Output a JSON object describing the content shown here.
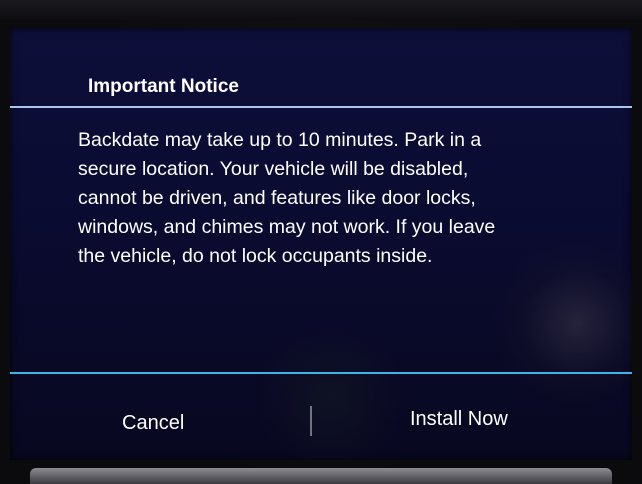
{
  "dialog": {
    "title": "Important Notice",
    "message_lines": [
      "Backdate may take up to 10 minutes. Park in a",
      "secure location. Your vehicle will be disabled,",
      "cannot be driven, and features like door locks,",
      "windows, and chimes may not work. If you leave",
      "the vehicle, do not lock occupants inside."
    ],
    "cancel_label": "Cancel",
    "install_label": "Install Now"
  },
  "colors": {
    "screen_background": "#0a0b30",
    "title_divider": "#a9c8ea",
    "button_divider": "#3fb3e6",
    "text": "#ffffff"
  }
}
